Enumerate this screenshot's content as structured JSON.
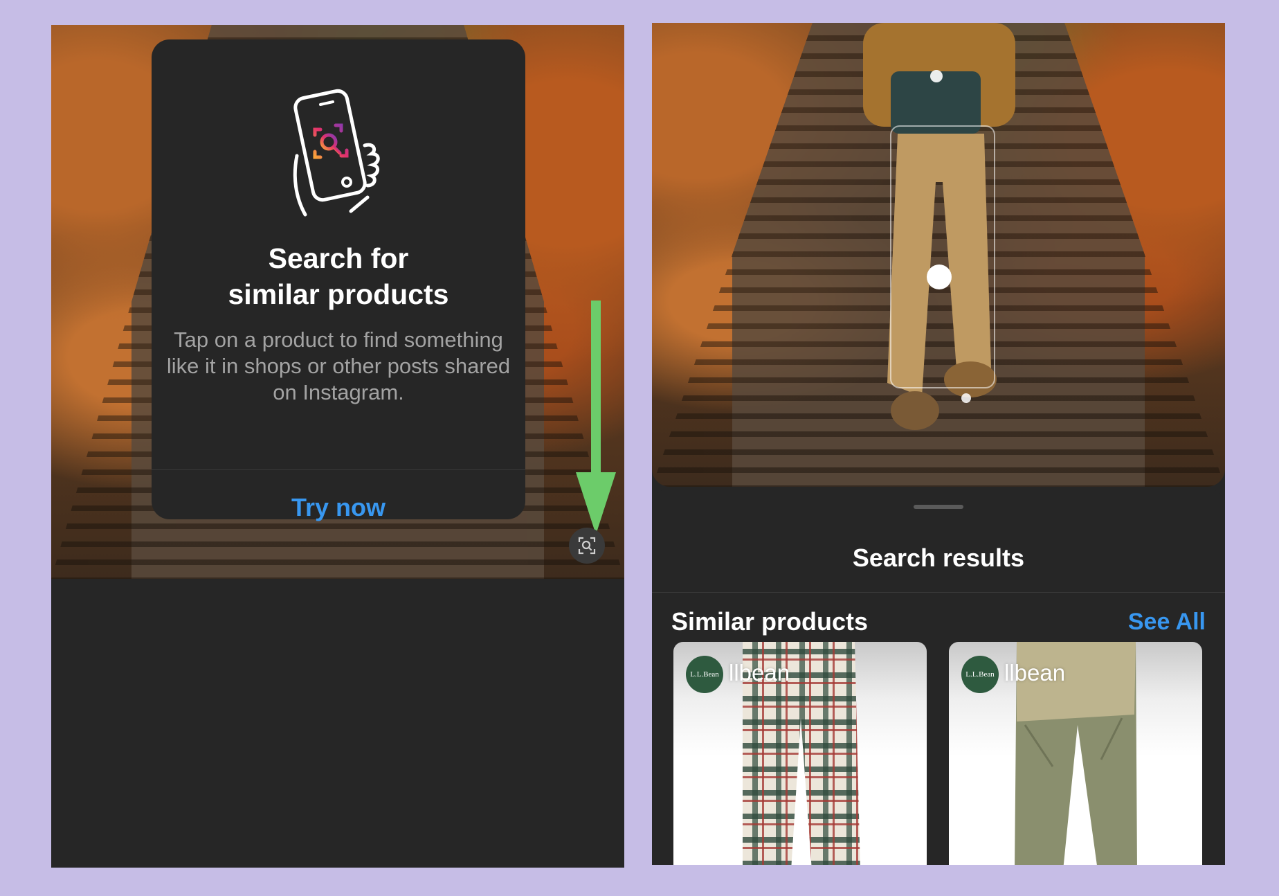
{
  "left_screen": {
    "modal": {
      "title_line1": "Search for",
      "title_line2": "similar products",
      "description": "Tap on a product to find something like it in shops or other posts shared on Instagram.",
      "cta_label": "Try now"
    },
    "annotation_arrow_color": "#6ccc6a",
    "visual_search_icon": "visual-search-icon"
  },
  "right_screen": {
    "sheet_title": "Search results",
    "section_heading": "Similar products",
    "see_all_label": "See All",
    "products": [
      {
        "brand_logo_text": "L.L.Bean",
        "brand_name": "llbean",
        "item": "plaid flannel pants"
      },
      {
        "brand_logo_text": "L.L.Bean",
        "brand_name": "llbean",
        "item": "khaki hiking pants"
      }
    ]
  },
  "colors": {
    "background": "#c6bde6",
    "panel": "#262626",
    "accent_link": "#3897f0",
    "brand_green": "#2e5a3f"
  }
}
